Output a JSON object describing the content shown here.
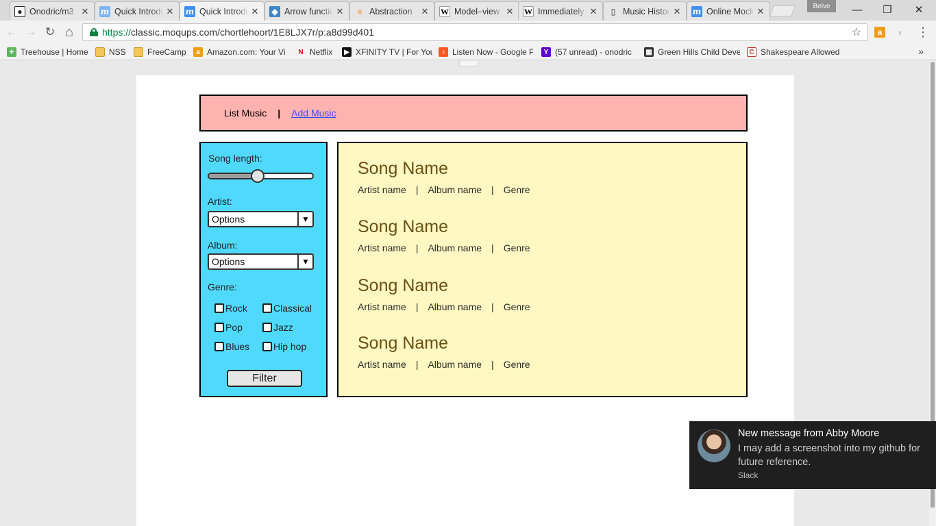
{
  "browser": {
    "tabs": [
      {
        "title": "Onodric/m3",
        "icon": "github-icon"
      },
      {
        "title": "Quick Introduction",
        "icon": "moqups-icon"
      },
      {
        "title": "Quick Introduction",
        "icon": "moqups-icon",
        "active": true
      },
      {
        "title": "Arrow functions",
        "icon": "arrow-functions-icon"
      },
      {
        "title": "Abstraction",
        "icon": "stackoverflow-icon"
      },
      {
        "title": "Model–view",
        "icon": "wikipedia-icon"
      },
      {
        "title": "Immediately",
        "icon": "wikipedia-icon"
      },
      {
        "title": "Music History",
        "icon": "document-icon"
      },
      {
        "title": "Online Mockup",
        "icon": "moqups-icon"
      }
    ],
    "close_glyph": "✕",
    "profile_name": "Belve",
    "window_controls": {
      "minimize": "—",
      "restore": "❐",
      "close": "✕"
    },
    "nav": {
      "back": "←",
      "forward": "→",
      "reload": "↻",
      "home": "⌂"
    },
    "url_scheme": "https://",
    "url_rest": "classic.moqups.com/chortlehoort/1E8LJX7r/p:a8d99d401",
    "star": "☆",
    "menu": "⋮",
    "bookmarks": [
      {
        "label": "Treehouse | Home",
        "icon": "treehouse-icon"
      },
      {
        "label": "NSS",
        "icon": "folder-icon"
      },
      {
        "label": "FreeCamp",
        "icon": "folder-icon"
      },
      {
        "label": "Amazon.com: Your Vi",
        "icon": "amazon-icon"
      },
      {
        "label": "Netflix",
        "icon": "netflix-icon"
      },
      {
        "label": "XFINITY TV | For You",
        "icon": "xfinity-icon"
      },
      {
        "label": "Listen Now - Google P",
        "icon": "google-play-music-icon"
      },
      {
        "label": "(57 unread) - onodric",
        "icon": "yahoo-icon"
      },
      {
        "label": "Green Hills Child Deve",
        "icon": "green-hills-icon"
      },
      {
        "label": "Shakespeare Allowed",
        "icon": "shakespeare-icon"
      }
    ],
    "bookmarks_more": "»",
    "handle": "···"
  },
  "mockup": {
    "nav": {
      "list": "List Music",
      "separator": "|",
      "add": "Add Music"
    },
    "filter": {
      "song_length_label": "Song length:",
      "song_length_value": 0.47,
      "artist_label": "Artist:",
      "artist_value": "Options",
      "album_label": "Album:",
      "album_value": "Options",
      "dropdown_arrow": "▼",
      "genre_label": "Genre:",
      "genres": [
        "Rock",
        "Classical",
        "Pop",
        "Jazz",
        "Blues",
        "Hip hop"
      ],
      "button": "Filter"
    },
    "songs": [
      {
        "name": "Song Name",
        "artist": "Artist name",
        "album": "Album name",
        "genre": "Genre"
      },
      {
        "name": "Song Name",
        "artist": "Artist name",
        "album": "Album name",
        "genre": "Genre"
      },
      {
        "name": "Song Name",
        "artist": "Artist name",
        "album": "Album name",
        "genre": "Genre"
      },
      {
        "name": "Song Name",
        "artist": "Artist name",
        "album": "Album name",
        "genre": "Genre"
      }
    ],
    "meta_separator": "|"
  },
  "notification": {
    "title": "New message from Abby Moore",
    "body": "I may add a screenshot into my github for future reference.",
    "app": "Slack"
  },
  "colors": {
    "header_bg": "#ffb3b0",
    "filter_bg": "#4fd9fd",
    "songs_bg": "#fff8c2",
    "song_name": "#6b4f14",
    "link": "#3b4bff"
  }
}
